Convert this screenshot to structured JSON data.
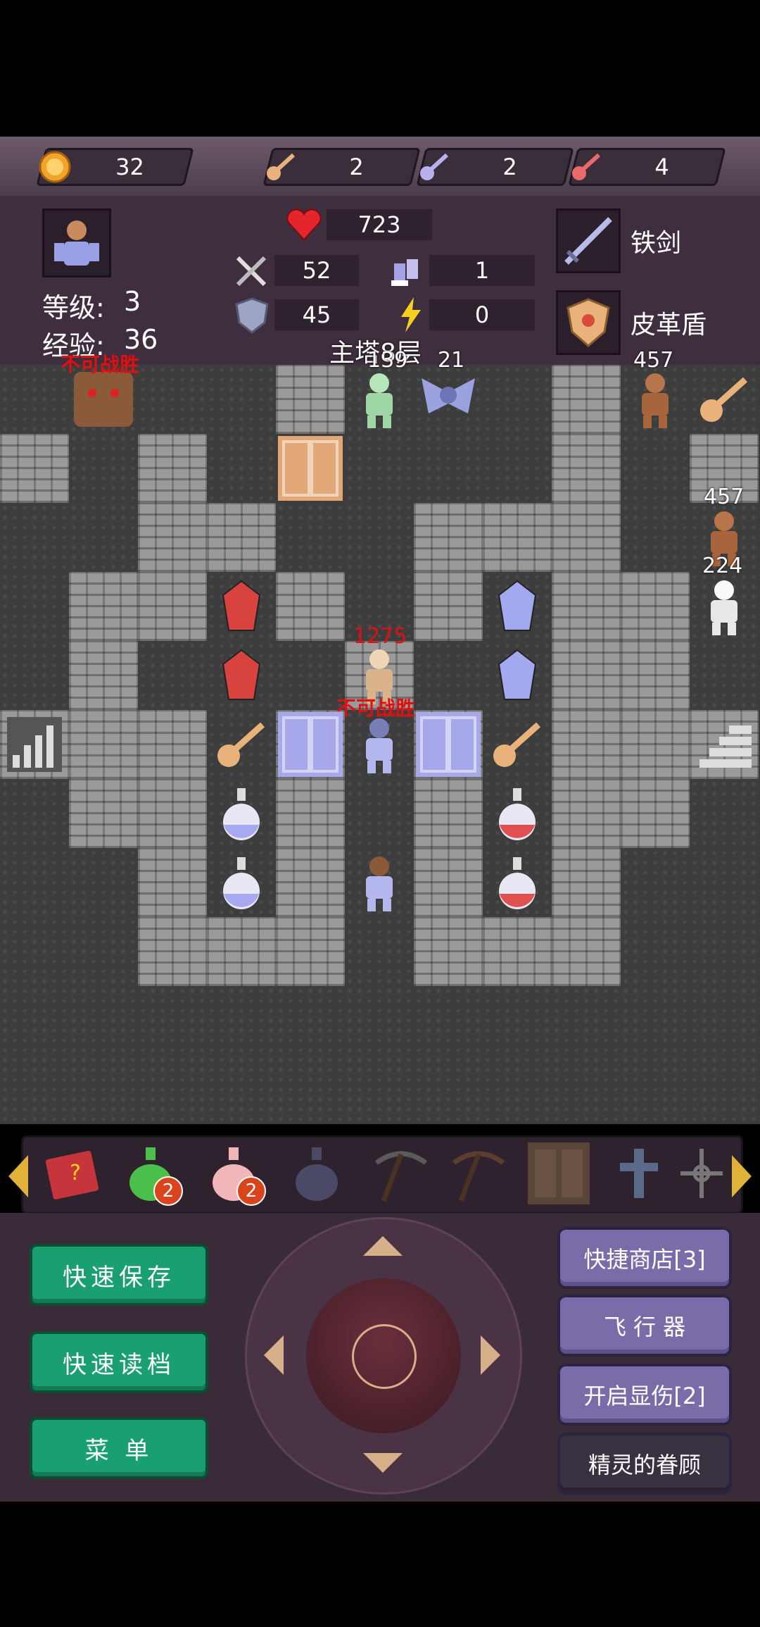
{
  "resources": {
    "gold": "32",
    "yellow_keys": "2",
    "blue_keys": "2",
    "red_keys": "4"
  },
  "player": {
    "hp": "723",
    "attack": "52",
    "defense": "45",
    "agility": "1",
    "magic": "0",
    "level_label": "等级:",
    "level": "3",
    "exp_label": "经验:",
    "exp": "36"
  },
  "equipment": {
    "weapon": "铁剑",
    "shield": "皮革盾"
  },
  "floor_title": "主塔8层",
  "map": {
    "labels": {
      "golem_warning": "不可战胜",
      "zombie_num": "139",
      "bat_num": "21",
      "ogre_top_num": "457",
      "ogre_right_num": "457",
      "skeleton_right_num": "224",
      "skeleton_center_dmg": "1275",
      "knight_warning": "不可战胜"
    }
  },
  "items": {
    "green_potion_count": "2",
    "pink_potion_count": "2"
  },
  "buttons": {
    "quick_save": "快速保存",
    "quick_load": "快速读档",
    "menu": "菜 单",
    "quick_shop": "快捷商店[3]",
    "flyer": "飞 行 器",
    "show_damage": "开启显伤[2]",
    "spirit": "精灵的眷顾"
  },
  "colors": {
    "action_green": "#1aa070",
    "action_purple": "#7a6ca8",
    "warning_red": "#e01010",
    "key_yellow": "#e8b27a",
    "key_blue": "#b7b2ee",
    "key_red": "#e86a6a"
  }
}
